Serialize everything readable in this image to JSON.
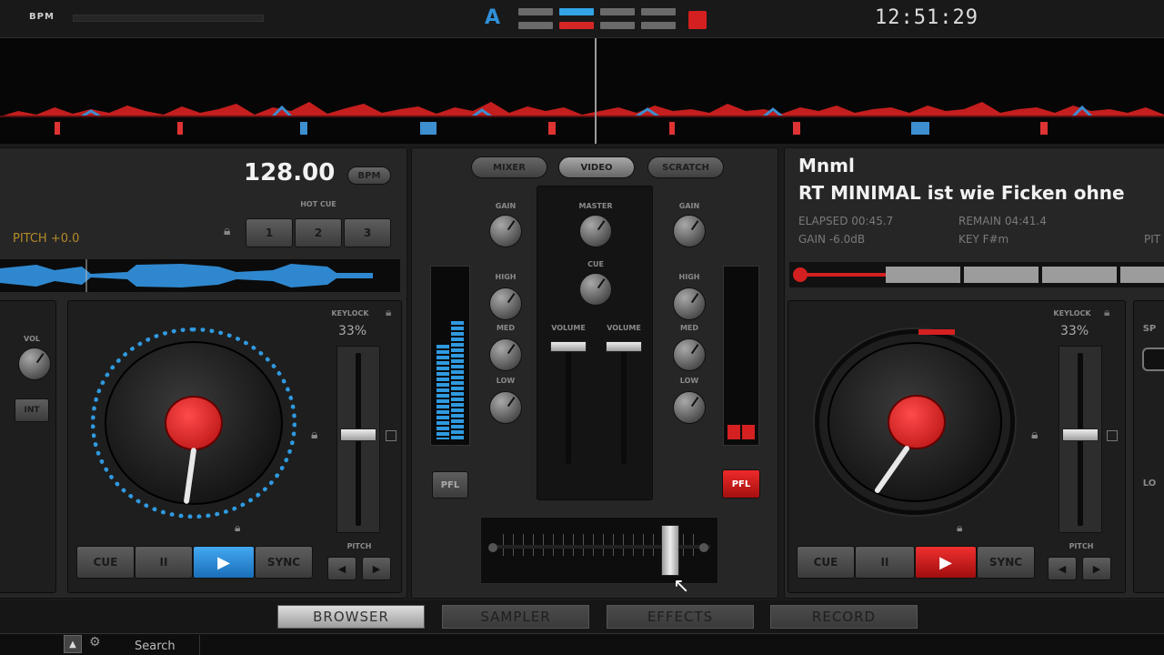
{
  "topbar": {
    "logo": "BPM",
    "clock": "12:51:29",
    "deck_a_label": "A",
    "accent_blue": "#2f90d8",
    "accent_red": "#d42020"
  },
  "deck_left": {
    "bpm": "128.00",
    "bpm_button": "BPM",
    "pitch": "PITCH +0.0",
    "hotcue_label": "HOT CUE",
    "hotcues": [
      "1",
      "2",
      "3"
    ],
    "keylock": "KEYLOCK",
    "keylock_value": "33%",
    "vol_label": "VOL",
    "side_button": "INT",
    "pitch_label": "PITCH",
    "transport": {
      "cue": "CUE",
      "pause": "II",
      "play": "▶",
      "sync": "SYNC"
    }
  },
  "deck_right": {
    "artist": "Mnml",
    "title": "RT MINIMAL ist wie Ficken ohne",
    "elapsed": "ELAPSED 00:45.7",
    "remain": "REMAIN 04:41.4",
    "gain": "GAIN -6.0dB",
    "key": "KEY F#m",
    "pitch_edge": "PIT",
    "keylock": "KEYLOCK",
    "keylock_value": "33%",
    "pitch_label": "PITCH",
    "transport": {
      "cue": "CUE",
      "pause": "II",
      "play": "▶",
      "sync": "SYNC"
    },
    "edge_label_top": "SP",
    "edge_label_bottom": "LO"
  },
  "mixer": {
    "tabs": [
      "MIXER",
      "VIDEO",
      "SCRATCH"
    ],
    "left_knobs": [
      "GAIN",
      "HIGH",
      "MED",
      "LOW"
    ],
    "right_knobs": [
      "GAIN",
      "HIGH",
      "MED",
      "LOW"
    ],
    "master_label": "MASTER",
    "cue_label": "CUE",
    "volume_left": "VOLUME",
    "volume_right": "VOLUME",
    "pfl_left": "PFL",
    "pfl_right": "PFL"
  },
  "bottom_tabs": [
    "BROWSER",
    "SAMPLER",
    "EFFECTS",
    "RECORD"
  ],
  "statusbar": {
    "search": "Search"
  }
}
